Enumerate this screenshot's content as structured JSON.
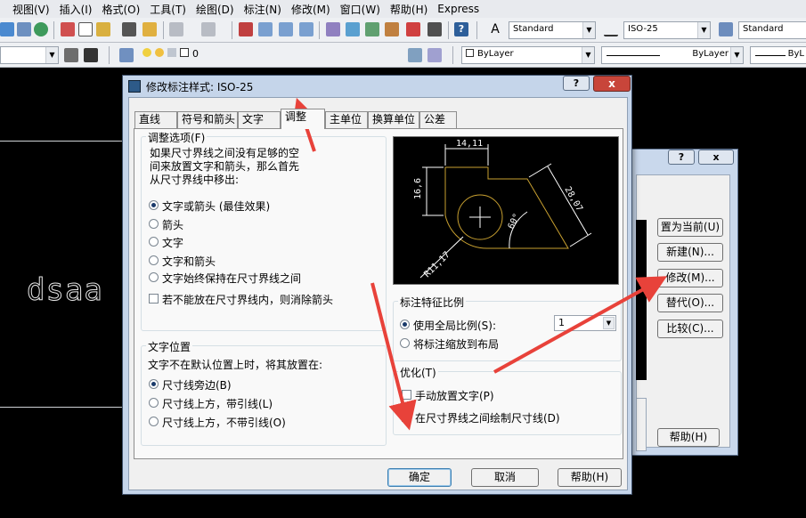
{
  "menu": [
    "视图(V)",
    "插入(I)",
    "格式(O)",
    "工具(T)",
    "绘图(D)",
    "标注(N)",
    "修改(M)",
    "窗口(W)",
    "帮助(H)",
    "Express"
  ],
  "toolbar": {
    "text_style": "Standard",
    "dim_style": "ISO-25",
    "table_style": "Standard",
    "layer_value": "0",
    "color": "ByLayer",
    "linetype": "ByLayer",
    "lineweight": "ByL"
  },
  "workspace_text": "dsaa",
  "back_dialog": {
    "help_tbtn": "?",
    "close_tbtn": "x",
    "buttons": [
      "置为当前(U)",
      "新建(N)...",
      "修改(M)...",
      "替代(O)...",
      "比较(C)..."
    ],
    "help_button": "帮助(H)"
  },
  "dialog": {
    "title": "修改标注样式: ISO-25",
    "help_tbtn": "?",
    "close_tbtn": "x",
    "tabs": [
      "直线",
      "符号和箭头",
      "文字",
      "调整",
      "主单位",
      "换算单位",
      "公差"
    ],
    "fit_options": {
      "legend": "调整选项(F)",
      "desc_1": "如果尺寸界线之间没有足够的空",
      "desc_2": "间来放置文字和箭头，那么首先",
      "desc_3": "从尺寸界线中移出:",
      "options": [
        "文字或箭头 (最佳效果)",
        "箭头",
        "文字",
        "文字和箭头",
        "文字始终保持在尺寸界线之间"
      ],
      "selected": 0,
      "suppress_arrows": "若不能放在尺寸界线内，则消除箭头"
    },
    "text_placement": {
      "legend": "文字位置",
      "desc": "文字不在默认位置上时，将其放置在:",
      "options": [
        "尺寸线旁边(B)",
        "尺寸线上方，带引线(L)",
        "尺寸线上方，不带引线(O)"
      ],
      "selected": 0
    },
    "scale": {
      "legend": "标注特征比例",
      "use_overall": "使用全局比例(S):",
      "value": "1",
      "scale_to_layout": "将标注缩放到布局"
    },
    "finetune": {
      "legend": "优化(T)",
      "manual_text": "手动放置文字(P)",
      "draw_dimline": "在尺寸界线之间绘制尺寸线(D)"
    },
    "preview": {
      "dim_top": "14,11",
      "dim_left": "16,6",
      "dim_right": "28,07",
      "angle": "60°",
      "radius": "R11,17"
    },
    "ok": "确定",
    "cancel": "取消",
    "help": "帮助(H)"
  },
  "colors": {
    "accent_arrow": "#e8423a",
    "preview_line": "#c8a030",
    "preview_dim": "#ffffff"
  }
}
